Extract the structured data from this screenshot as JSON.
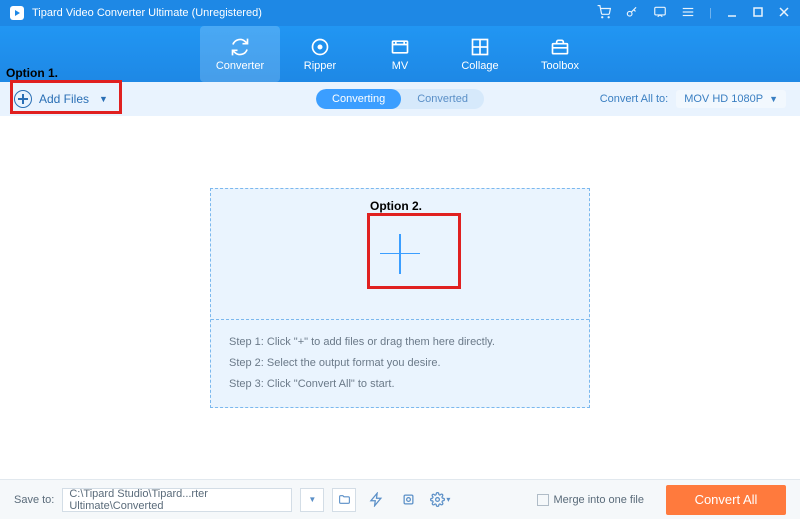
{
  "titlebar": {
    "title": "Tipard Video Converter Ultimate (Unregistered)"
  },
  "toolbar": {
    "converter": "Converter",
    "ripper": "Ripper",
    "mv": "MV",
    "collage": "Collage",
    "toolbox": "Toolbox"
  },
  "subbar": {
    "add_files": "Add Files",
    "converting": "Converting",
    "converted": "Converted",
    "convert_all_to": "Convert All to:",
    "format": "MOV HD 1080P"
  },
  "dropzone": {
    "step1": "Step 1: Click \"+\" to add files or drag them here directly.",
    "step2": "Step 2: Select the output format you desire.",
    "step3": "Step 3: Click \"Convert All\" to start."
  },
  "footer": {
    "save_to_label": "Save to:",
    "save_to_path": "C:\\Tipard Studio\\Tipard...rter Ultimate\\Converted",
    "merge": "Merge into one file",
    "convert_all": "Convert All"
  },
  "annotations": {
    "option1": "Option 1.",
    "option2": "Option 2."
  }
}
